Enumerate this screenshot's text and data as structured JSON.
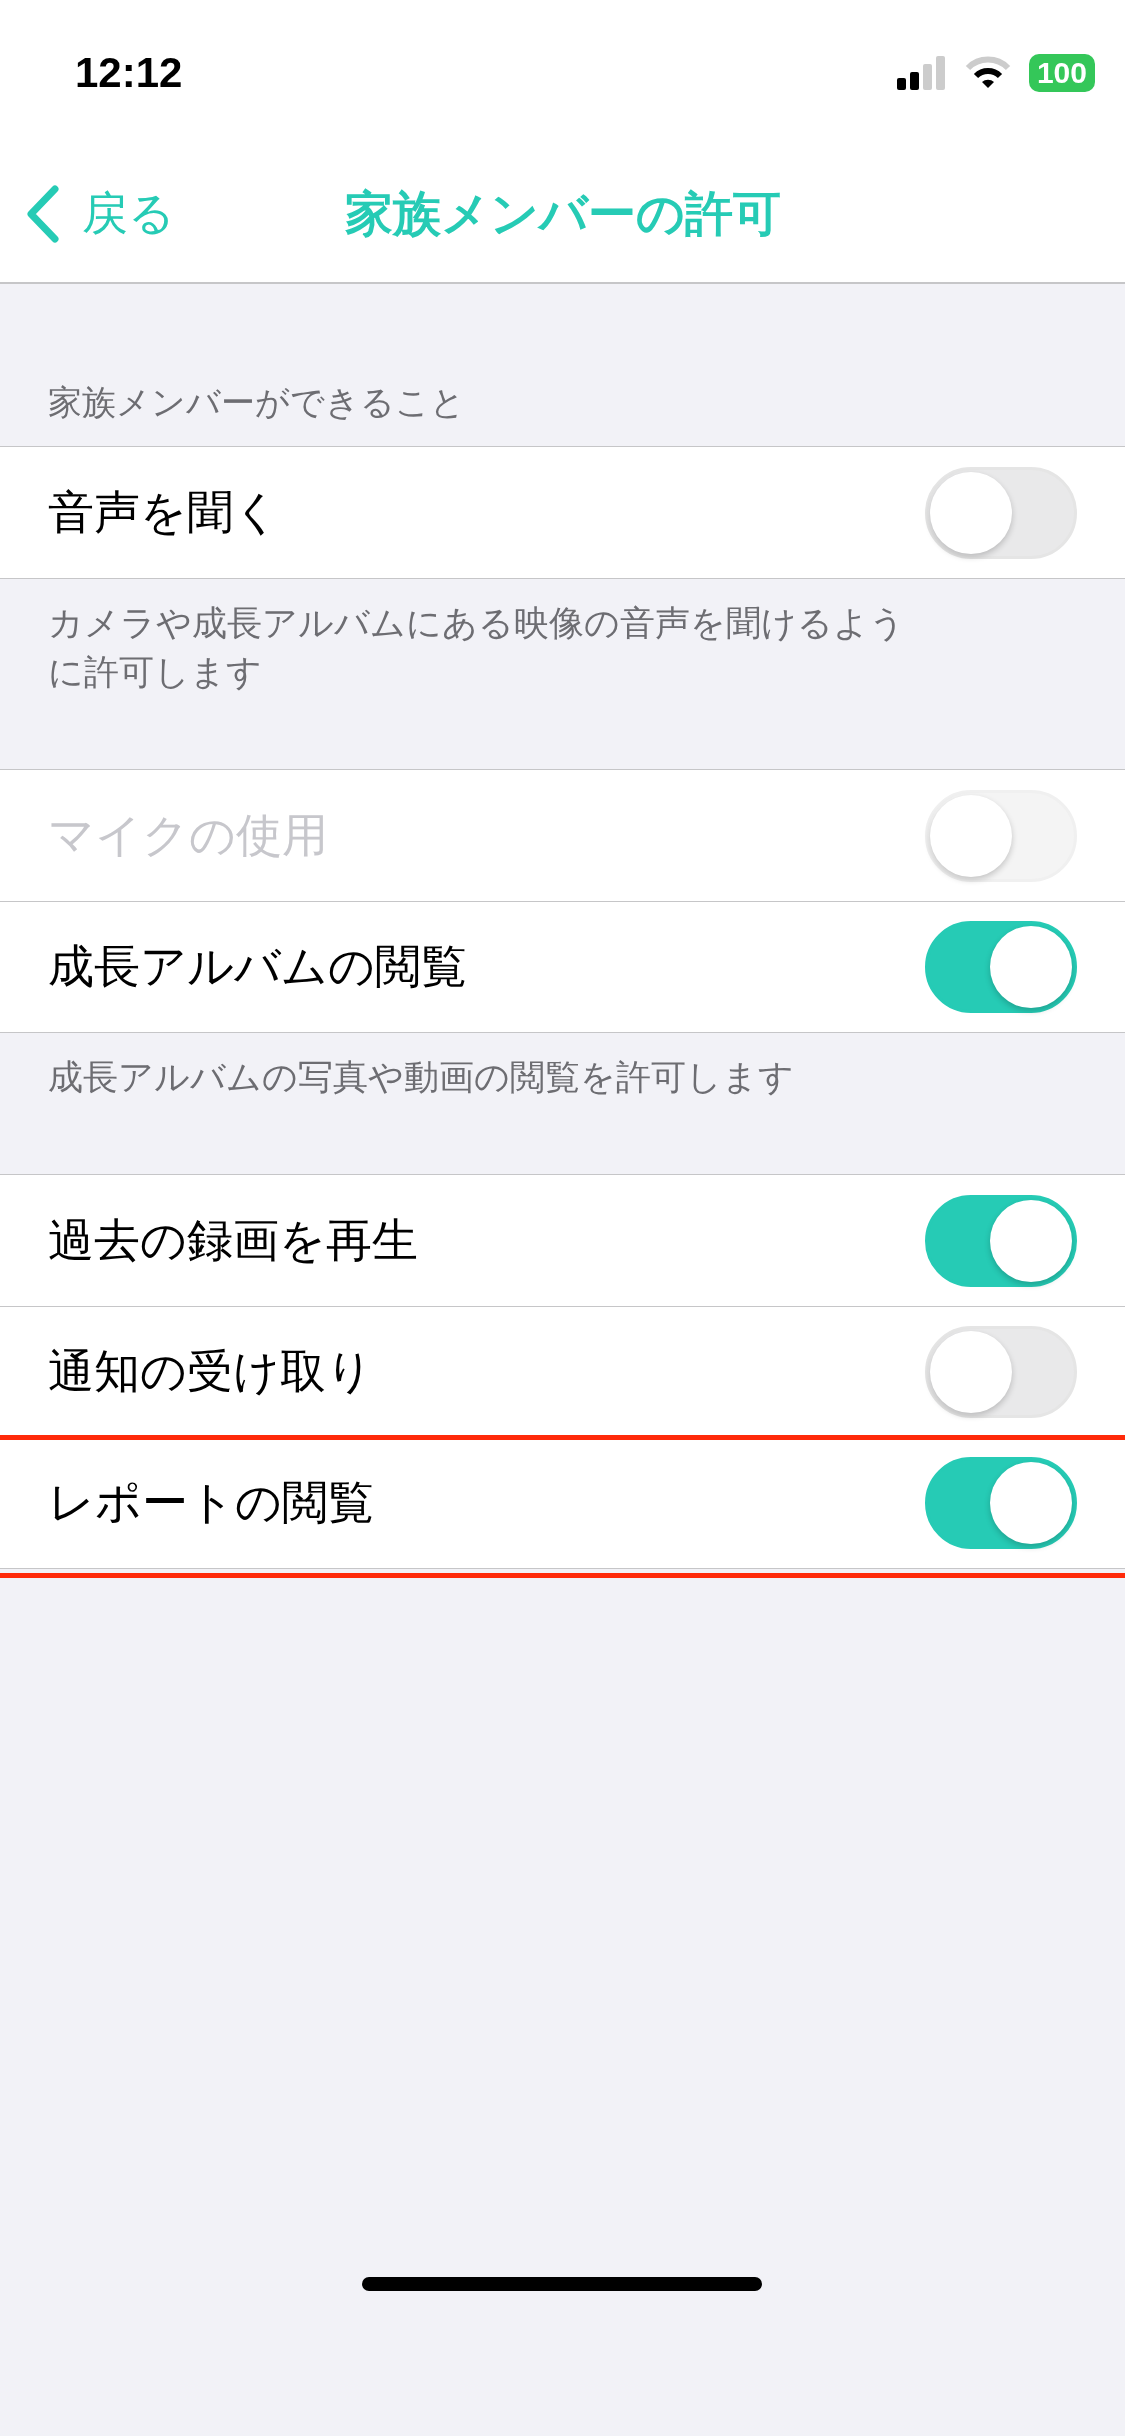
{
  "status_bar": {
    "time": "12:12",
    "battery": "100"
  },
  "nav": {
    "back": "戻る",
    "title": "家族メンバーの許可"
  },
  "sections": [
    {
      "header": "家族メンバーができること",
      "rows": [
        {
          "label": "音声を聞く",
          "on": false,
          "disabled": false,
          "highlighted": false
        }
      ],
      "footer": "カメラや成長アルバムにある映像の音声を聞けるように許可します"
    },
    {
      "rows": [
        {
          "label": "マイクの使用",
          "on": false,
          "disabled": true,
          "highlighted": false
        },
        {
          "label": "成長アルバムの閲覧",
          "on": true,
          "disabled": false,
          "highlighted": false
        }
      ],
      "footer": "成長アルバムの写真や動画の閲覧を許可します"
    },
    {
      "rows": [
        {
          "label": "過去の録画を再生",
          "on": true,
          "disabled": false,
          "highlighted": false
        },
        {
          "label": "通知の受け取り",
          "on": false,
          "disabled": false,
          "highlighted": false
        },
        {
          "label": "レポートの閲覧",
          "on": true,
          "disabled": false,
          "highlighted": true
        }
      ]
    }
  ]
}
